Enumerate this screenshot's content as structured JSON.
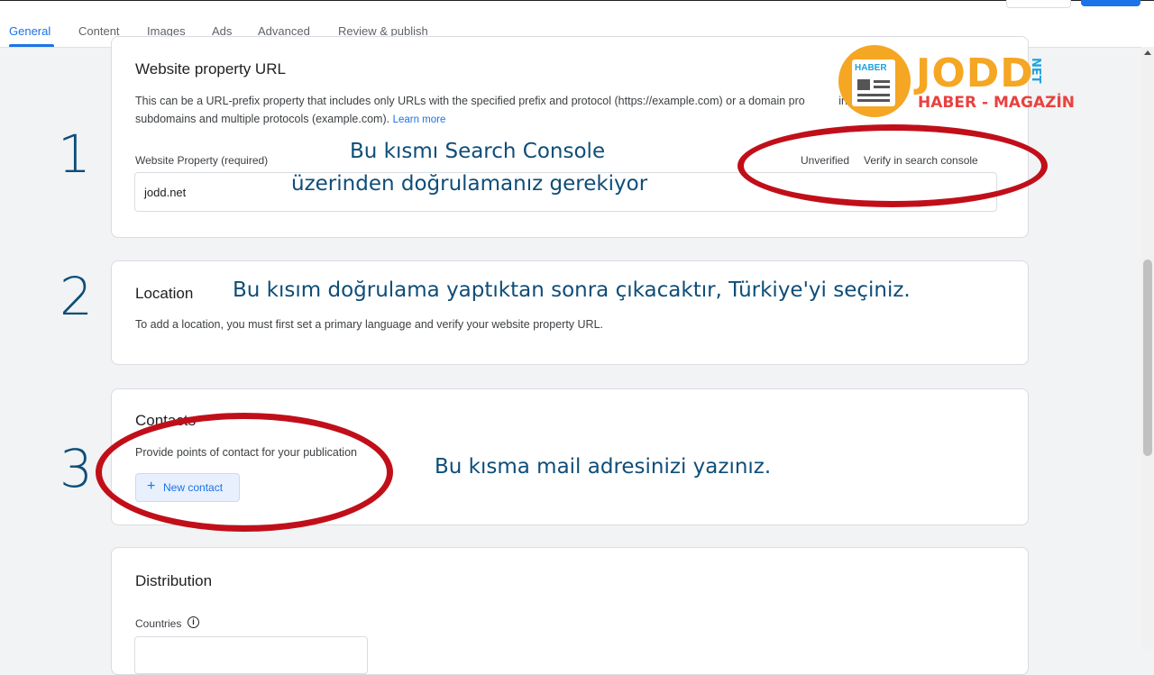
{
  "tabs": [
    {
      "label": "General",
      "active": true
    },
    {
      "label": "Content"
    },
    {
      "label": "Images"
    },
    {
      "label": "Ads"
    },
    {
      "label": "Advanced"
    },
    {
      "label": "Review & publish"
    }
  ],
  "website_section": {
    "title": "Website property URL",
    "description_line1": "This can be a URL-prefix property that includes only URLs with the specified prefix and protocol (https://example.com) or a domain pro",
    "description_line1_tail": "includes",
    "description_line2": "subdomains and multiple protocols (example.com).",
    "learn_more": "Learn more",
    "field_label": "Website Property (required)",
    "status": "Unverified",
    "verify_link": "Verify in search console",
    "value": "jodd.net"
  },
  "location_section": {
    "title": "Location",
    "description": "To add a location, you must first set a primary language and verify your website property URL."
  },
  "contacts_section": {
    "title": "Contacts",
    "description": "Provide points of contact for your publication",
    "new_contact_label": "New contact",
    "plus_icon": "+"
  },
  "distribution_section": {
    "title": "Distribution",
    "countries_label": "Countries",
    "info_icon": "i"
  },
  "annotations": {
    "step1": "1",
    "step2": "2",
    "step3": "3",
    "note1_line1": "Bu kısmı Search Console",
    "note1_line2": "üzerinden doğrulamanız gerekiyor",
    "note2": "Bu kısım doğrulama yaptıktan sonra çıkacaktır, Türkiye'yi seçiniz.",
    "note3": "Bu kısma mail adresinizi yazınız.",
    "ellipse_color": "#c10f1a",
    "text_color": "#0e4d78"
  },
  "logo": {
    "badge": "HABER",
    "word": "JODD",
    "suffix": "NET",
    "tagline": "HABER - MAGAZİN"
  },
  "colors": {
    "accent": "#1a73e8",
    "logo_orange": "#f5a623",
    "logo_red": "#e8423f"
  }
}
